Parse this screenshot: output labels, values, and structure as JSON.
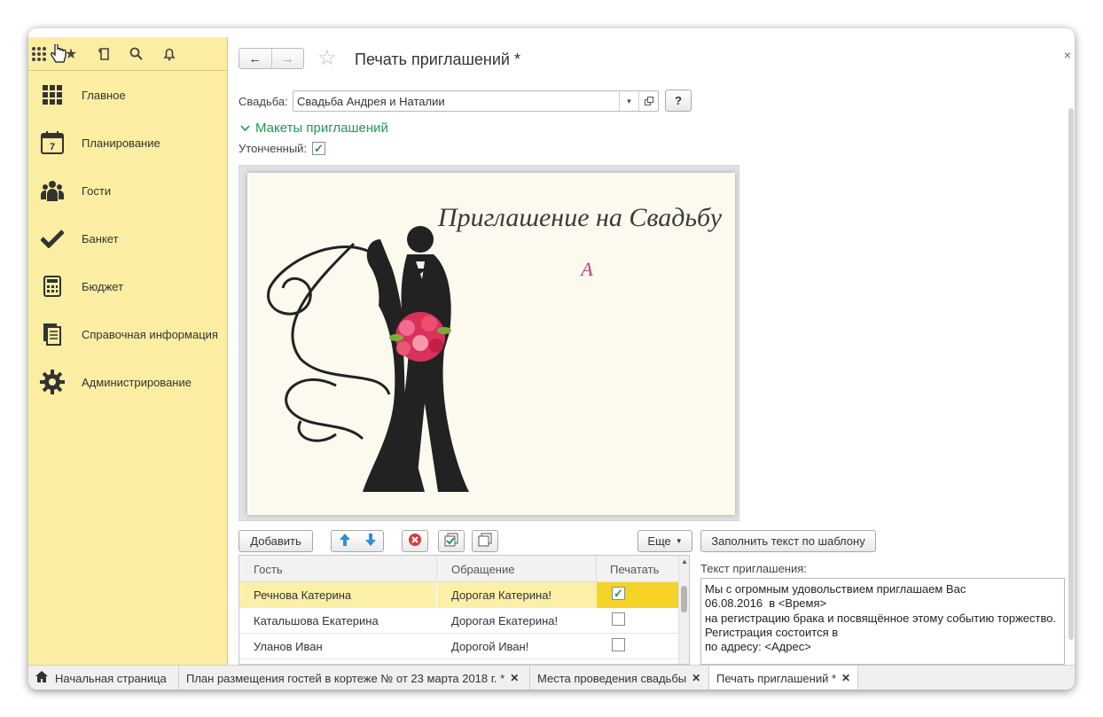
{
  "sidebar": {
    "items": [
      {
        "label": "Главное",
        "icon": "grid-icon"
      },
      {
        "label": "Планирование",
        "icon": "calendar-icon"
      },
      {
        "label": "Гости",
        "icon": "people-icon"
      },
      {
        "label": "Банкет",
        "icon": "checkmark-icon"
      },
      {
        "label": "Бюджет",
        "icon": "calculator-icon"
      },
      {
        "label": "Справочная информация",
        "icon": "documents-icon"
      },
      {
        "label": "Администрирование",
        "icon": "gear-icon"
      }
    ],
    "calendar_day": "7"
  },
  "header": {
    "title": "Печать приглашений *",
    "back": "←",
    "forward": "→",
    "close": "×"
  },
  "form": {
    "wedding_label": "Свадьба:",
    "wedding_value": "Свадьба Андрея и Наталии",
    "help": "?",
    "group_title": "Макеты приглашений",
    "refined_label": "Утонченный:"
  },
  "preview": {
    "title": "Приглашение на Свадьбу",
    "monogram": "A"
  },
  "toolbar": {
    "add": "Добавить",
    "more": "Еще",
    "fill_template": "Заполнить текст по шаблону"
  },
  "table": {
    "columns": [
      "Гость",
      "Обращение",
      "Печатать"
    ],
    "rows": [
      {
        "guest": "Речнова Катерина",
        "greeting": "Дорогая Катерина!",
        "print": true
      },
      {
        "guest": "Катальшова Екатерина",
        "greeting": "Дорогая Екатерина!",
        "print": false
      },
      {
        "guest": "Уланов Иван",
        "greeting": "Дорогой Иван!",
        "print": false
      }
    ]
  },
  "invitation": {
    "label": "Текст приглашения:",
    "text": "Мы с огромным удовольствием приглашаем Вас\n06.08.2016  в <Время>\nна регистрацию брака и посвящённое этому событию торжество.\nРегистрация состоится в\nпо адресу: <Адрес>"
  },
  "tabs": [
    {
      "label": "Начальная страница"
    },
    {
      "label": "План размещения гостей в кортеже №  от 23 марта 2018 г. *"
    },
    {
      "label": "Места проведения свадьбы"
    },
    {
      "label": "Печать приглашений *"
    }
  ],
  "colors": {
    "sidebar_bg": "#fbeda2",
    "accent_green": "#1d9a4e",
    "selected_row": "#fcf0a8",
    "print_cell": "#f5d327"
  }
}
